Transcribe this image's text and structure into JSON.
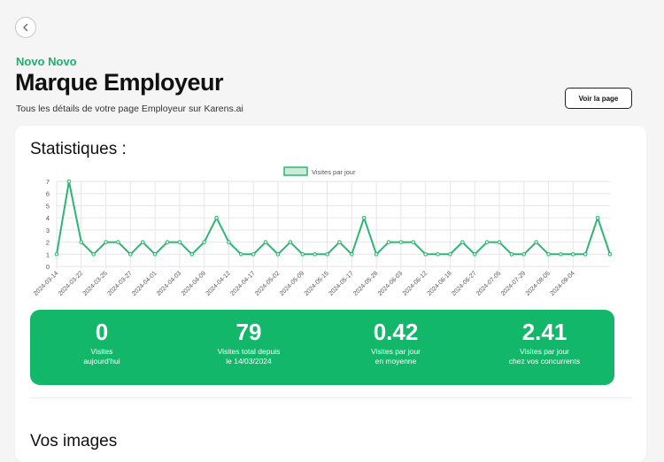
{
  "header": {
    "company": "Novo Novo",
    "title": "Marque Employeur",
    "subtitle": "Tous les détails de votre page Employeur sur Karens.ai",
    "view_button": "Voir la page"
  },
  "stats": {
    "title": "Statistiques :",
    "kpis": [
      {
        "value": "0",
        "label_line1": "Visites",
        "label_line2": "aujourd'hui"
      },
      {
        "value": "79",
        "label_line1": "Visites total depuis",
        "label_line2": "le 14/03/2024"
      },
      {
        "value": "0.42",
        "label_line1": "Visites par jour",
        "label_line2": "en moyenne"
      },
      {
        "value": "2.41",
        "label_line1": "Visites par jour",
        "label_line2": "chez vos concurrents"
      }
    ]
  },
  "images": {
    "title": "Vos images"
  },
  "colors": {
    "accent": "#12b76a",
    "line": "#2bb673"
  },
  "chart_data": {
    "type": "line",
    "series": [
      {
        "name": "Visites par jour",
        "values": [
          1,
          7,
          2,
          1,
          2,
          2,
          1,
          2,
          1,
          2,
          2,
          1,
          2,
          4,
          2,
          1,
          1,
          2,
          1,
          2,
          1,
          1,
          1,
          2,
          1,
          4,
          1,
          2,
          2,
          2,
          1,
          1,
          1,
          2,
          1,
          2,
          2,
          1,
          1,
          2,
          1,
          1,
          1,
          1,
          4,
          1
        ]
      }
    ],
    "x_labels": [
      "2024-03-14",
      "2024-03-22",
      "2024-03-25",
      "2024-03-27",
      "2024-04-01",
      "2024-04-03",
      "2024-04-09",
      "2024-04-12",
      "2024-04-17",
      "2024-05-02",
      "2024-05-09",
      "2024-05-15",
      "2024-05-17",
      "2024-05-28",
      "2024-06-03",
      "2024-06-12",
      "2024-06-18",
      "2024-06-27",
      "2024-07-05",
      "2024-07-29",
      "2024-08-05",
      "2024-09-04"
    ],
    "y_ticks": [
      0,
      1,
      2,
      3,
      4,
      5,
      6,
      7
    ],
    "ylim": [
      0,
      7
    ],
    "legend": "top",
    "grid": true
  }
}
